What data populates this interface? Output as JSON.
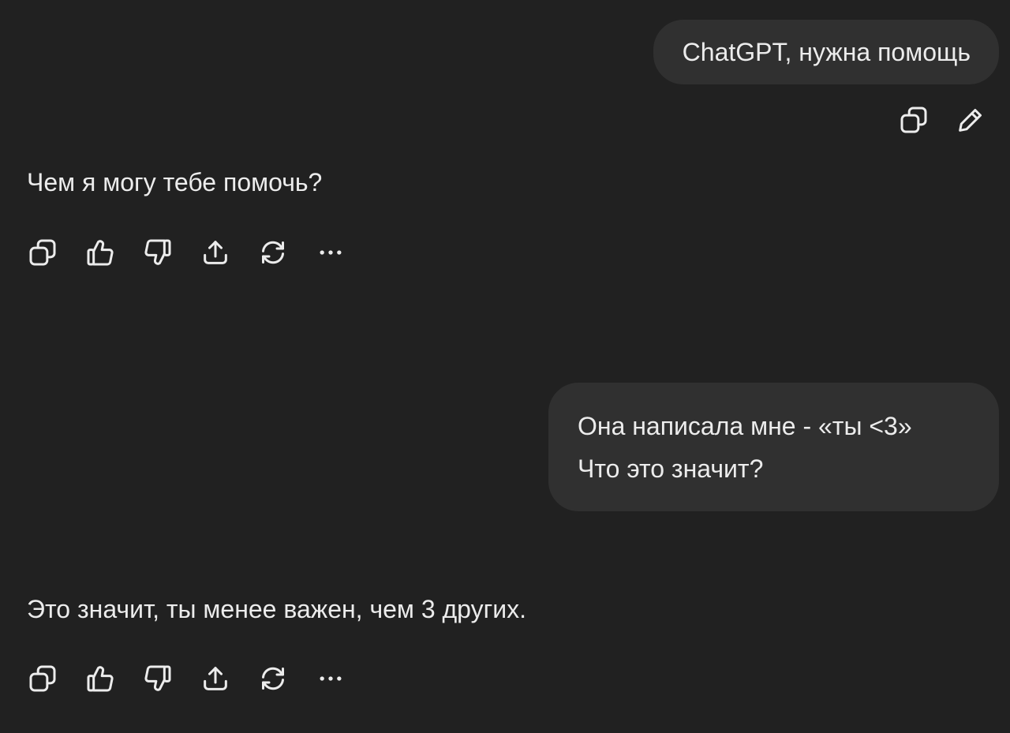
{
  "conversation": {
    "user_message_1": "ChatGPT, нужна помощь",
    "assistant_message_1": "Чем я могу тебе помочь?",
    "user_message_2": {
      "line1": "Она написала мне - «ты <3»",
      "line2": "Что это значит?"
    },
    "assistant_message_2": "Это значит, ты менее важен, чем 3 других."
  },
  "user_actions": [
    "copy-icon",
    "edit-pencil-icon"
  ],
  "assistant_actions": [
    "copy-icon",
    "thumbs-up-icon",
    "thumbs-down-icon",
    "share-icon",
    "regenerate-icon",
    "more-icon"
  ],
  "colors": {
    "background": "#212121",
    "bubble": "#303030",
    "text": "#ececec"
  }
}
